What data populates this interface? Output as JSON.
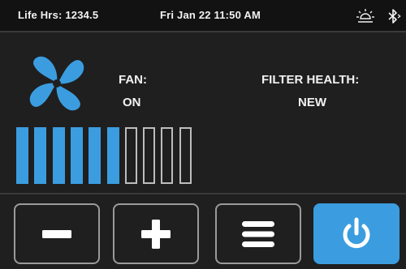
{
  "status_bar": {
    "life_hours": "Life Hrs: 1234.5",
    "datetime": "Fri Jan 22  11:50 AM",
    "icons": [
      "sun-icon",
      "bluetooth-icon"
    ]
  },
  "fan": {
    "label": "FAN:",
    "state": "ON",
    "icon": "fan-icon",
    "speed_level": 6,
    "speed_max": 10
  },
  "filter": {
    "label": "FILTER HEALTH:",
    "state": "NEW"
  },
  "buttons": {
    "decrease": "minus-icon",
    "increase": "plus-icon",
    "menu": "menu-icon",
    "power": "power-icon"
  },
  "colors": {
    "accent": "#3b9de0",
    "background": "#1f1f1f",
    "status_bar": "#121212",
    "segment_off_border": "#bdbdbd"
  }
}
